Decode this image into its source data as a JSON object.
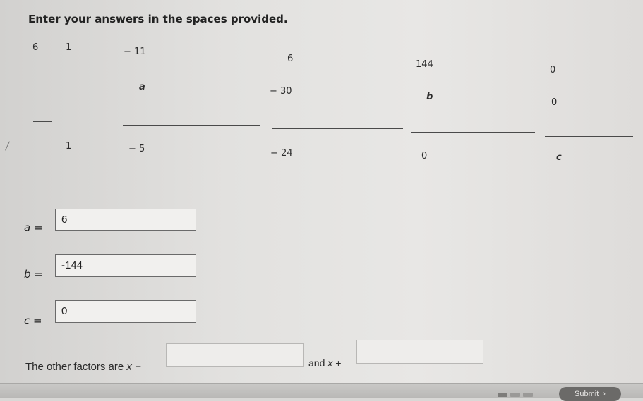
{
  "instructions": "Enter your answers in the spaces provided.",
  "synthetic_division": {
    "divisor": "6",
    "row1": [
      "1",
      "− 11",
      "6",
      "144",
      "0"
    ],
    "row2": [
      "a",
      "− 30",
      "b",
      "0"
    ],
    "row3": [
      "1",
      "− 5",
      "− 24",
      "0",
      "c"
    ]
  },
  "fields": [
    {
      "label": "a =",
      "value": "6"
    },
    {
      "label": "b =",
      "value": "-144"
    },
    {
      "label": "c =",
      "value": "0"
    }
  ],
  "factors": {
    "prefix": "The other factors are",
    "x_minus": "x −",
    "and": "and",
    "x_plus": "x +",
    "value1": "",
    "value2": ""
  },
  "submit": {
    "label": "Submit",
    "icon": "chevron-right-icon"
  }
}
